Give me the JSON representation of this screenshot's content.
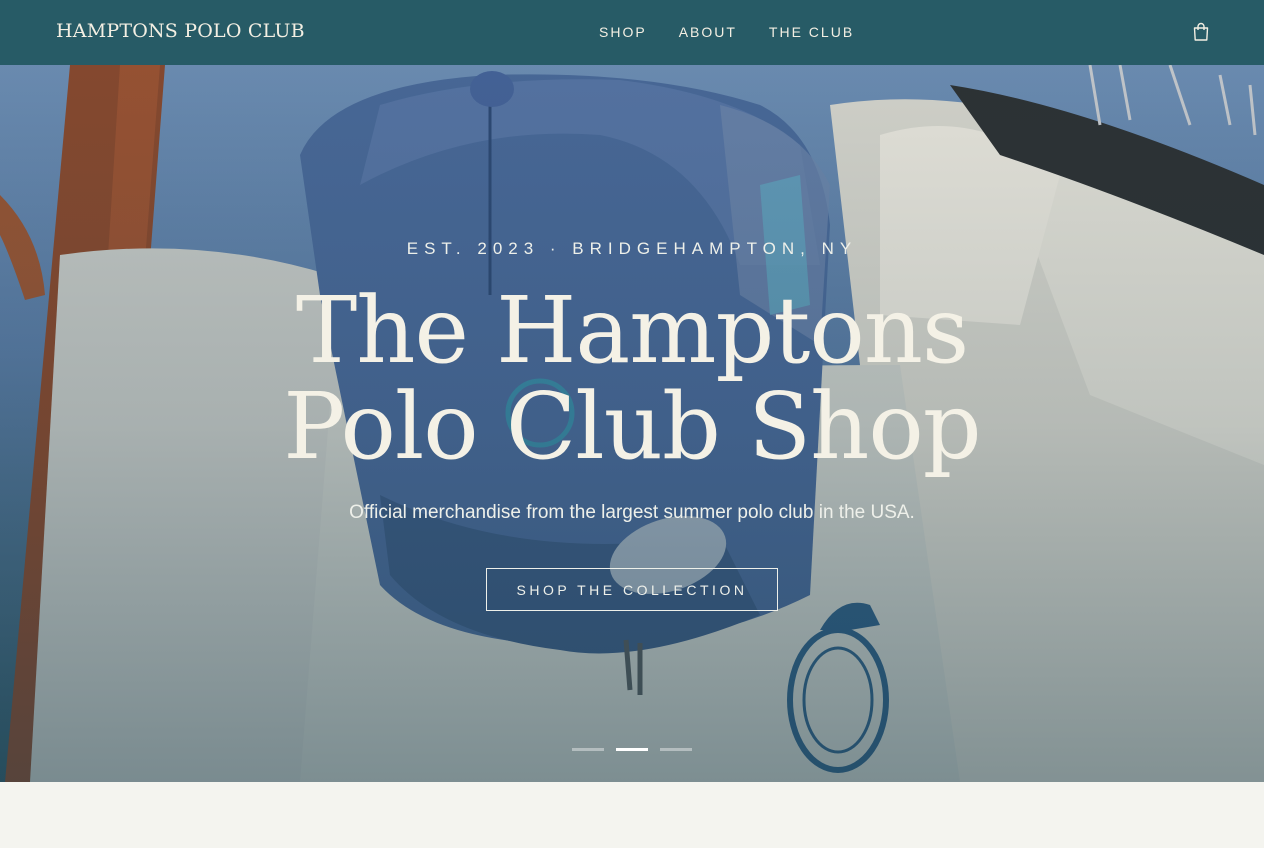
{
  "header": {
    "logo": "HAMPTONS POLO CLUB",
    "nav": [
      "SHOP",
      "ABOUT",
      "THE CLUB"
    ],
    "cart_icon": "shopping-bag-icon"
  },
  "hero": {
    "eyebrow": "EST. 2023 · BRIDGEHAMPTON, NY",
    "title_line1": "The Hamptons",
    "title_line2": "Polo Club Shop",
    "subtitle": "Official merchandise from the largest summer polo club in the USA.",
    "cta": "SHOP THE COLLECTION",
    "slides": {
      "count": 3,
      "active": 2
    }
  },
  "colors": {
    "header_bg": "#275b66",
    "text_light": "#f3efe3",
    "page_bg": "#f4f4ef"
  }
}
